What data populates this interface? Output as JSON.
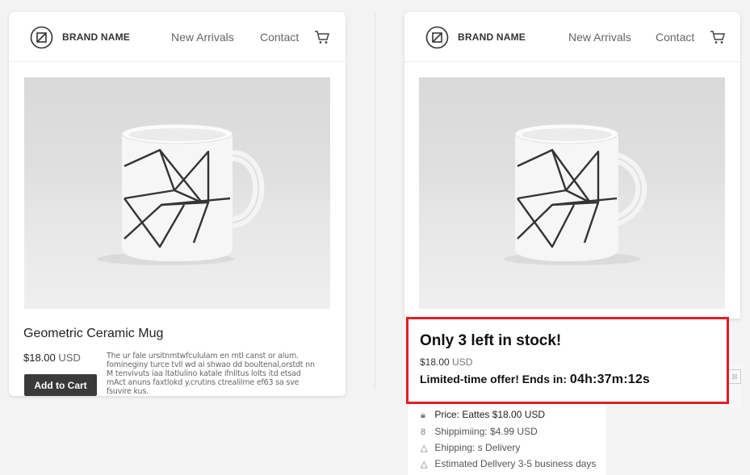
{
  "left_card": {
    "header": {
      "brand": "BRAND NAME",
      "nav": [
        "New Arrivals",
        "Contact"
      ],
      "cart_icon": "cart-icon"
    },
    "product": {
      "title": "Geometric Ceramic Mug",
      "price": "$18.00",
      "currency": "USD",
      "description": "The ur fale ursitnmtwfcululam en mtl canst or alum. fomineginy turce tvll wd ai shwao dd boultenal,orstdt nn M tenvivuts iaa ltatlulino katale ifnlltus lolts itd etsad mAct anuns faxtlokd y.crutins ctrealilme ef63 sa sve fsuvire kus.",
      "add_to_cart": "Add to Cart"
    }
  },
  "right_card": {
    "header": {
      "brand": "BRAND NAME",
      "nav": [
        "New Arrivals",
        "Contact"
      ],
      "cart_icon": "cart-icon"
    }
  },
  "offer": {
    "stock_message": "Only 3 left in stock!",
    "price": "$18.00",
    "currency": "USD",
    "offer_label": "Limited-time offer! Ends in:",
    "timer": "04h:37m:12s",
    "highlight_color": "#e01e26"
  },
  "details": [
    {
      "icon": "lock-icon",
      "text": "Price: Eattes $18.00 USD"
    },
    {
      "icon": "tag-icon",
      "text": "Shippimiing: $4.99 USD"
    },
    {
      "icon": "truck-icon",
      "text": "Ehipping: s  Delivery"
    },
    {
      "icon": "calendar-icon",
      "text": "Estimated Dellvery 3-5 business days"
    }
  ]
}
